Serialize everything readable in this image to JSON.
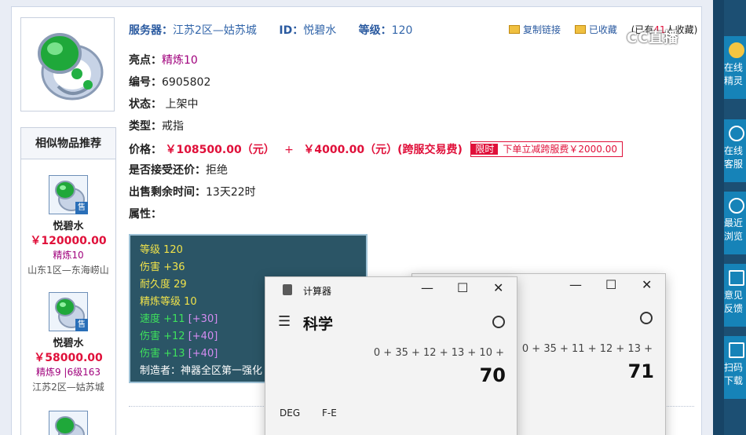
{
  "header": {
    "server_label": "服务器：",
    "server_value": "江苏2区—姑苏城",
    "id_label": "ID：",
    "id_value": "悦碧水",
    "level_label": "等级：",
    "level_value": "120"
  },
  "actions": {
    "copy_link": "复制链接",
    "favorited": "已收藏",
    "fav_count_prefix": "(已有",
    "fav_count": "41",
    "fav_count_suffix": "人收藏)"
  },
  "watermark": "CC直播",
  "item": {
    "highlight_label": "亮点：",
    "highlight_value": "精炼10",
    "number_label": "编号：",
    "number_value": "6905802",
    "status_label": "状态：",
    "status_value": "上架中",
    "type_label": "类型：",
    "type_value": "戒指",
    "price_label": "价格：",
    "price_value": "￥108500.00（元）",
    "price_plus": "+",
    "fee_value": "￥4000.00（元）(跨服交易费)",
    "limit_tag": "限时",
    "limit_text": "下单立减跨服费￥2000.00",
    "bargain_label": "是否接受还价：",
    "bargain_value": "拒绝",
    "time_label": "出售剩余时间：",
    "time_value": "13天22时",
    "attr_label": "属性："
  },
  "attributes": [
    {
      "text": "等级 120",
      "color": "yellow"
    },
    {
      "text": "伤害 +36",
      "color": "yellow"
    },
    {
      "text": "耐久度 29",
      "color": "yellow"
    },
    {
      "text": "精炼等级 10",
      "color": "yellow"
    },
    {
      "text": "速度 +11",
      "extra": "[+30]",
      "color": "green"
    },
    {
      "text": "伤害 +12",
      "extra": "[+40]",
      "color": "green"
    },
    {
      "text": "伤害 +13",
      "extra": "[+40]",
      "color": "green"
    },
    {
      "text": "制造者：神器全区第一强化",
      "color": "white"
    }
  ],
  "similar": {
    "title": "相似物品推荐",
    "sale_tag": "售",
    "items": [
      {
        "name": "悦碧水",
        "price": "￥120000.00",
        "refine": "精炼10",
        "server": "山东1区—东海崂山"
      },
      {
        "name": "悦碧水",
        "price": "￥58000.00",
        "refine": "精炼9 |6级163",
        "server": "江苏2区—姑苏城"
      }
    ]
  },
  "sidebar": [
    {
      "label": "在线精灵"
    },
    {
      "label": "在线客服"
    },
    {
      "label": "最近浏览"
    },
    {
      "label": "意见反馈"
    },
    {
      "label": "扫码下载"
    }
  ],
  "calculators": [
    {
      "title": "计算器",
      "mode": "科学",
      "expression": "0 + 35 + 12 + 13 + 10 +",
      "result": "70",
      "deg": "DEG",
      "fe": "F-E"
    },
    {
      "title": "",
      "mode": "",
      "expression": "0 + 35 + 11 + 12 + 13 +",
      "result": "71"
    }
  ]
}
